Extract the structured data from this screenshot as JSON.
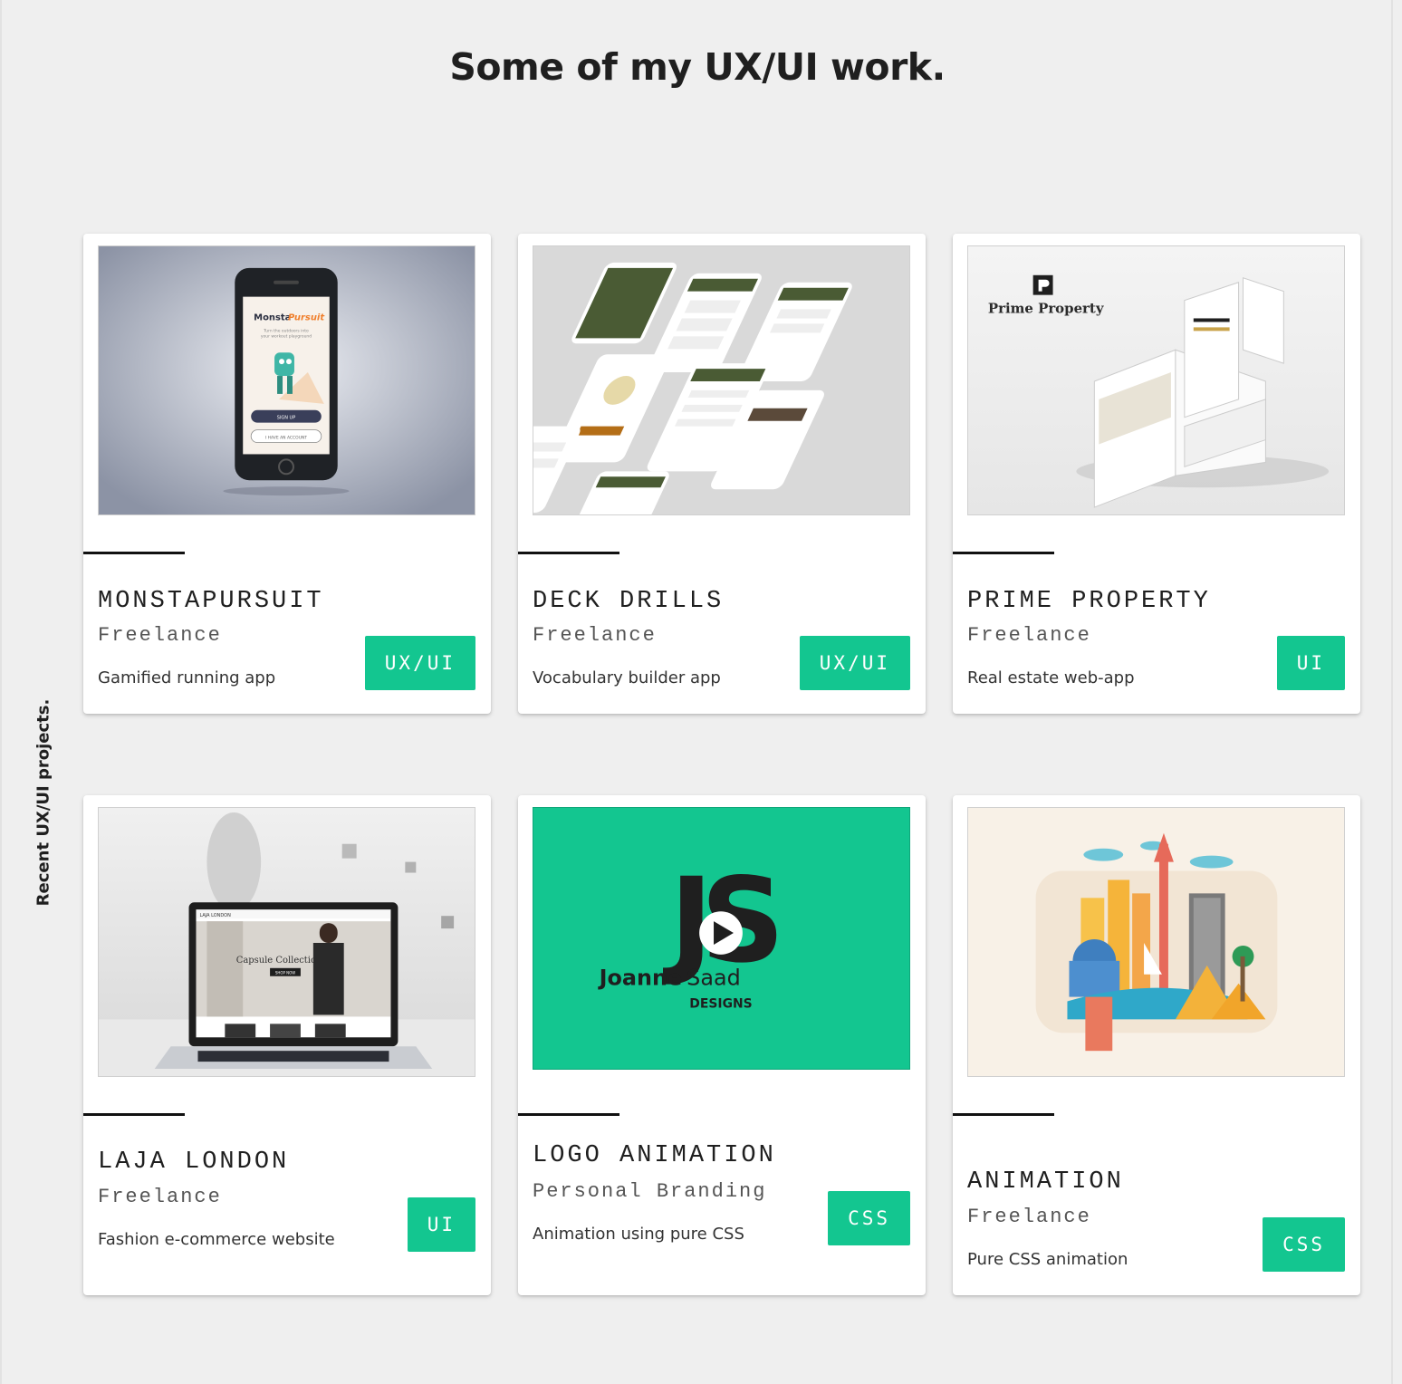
{
  "page": {
    "title": "Some of my UX/UI work."
  },
  "side_label": "Recent UX/UI projects.",
  "colors": {
    "accent": "#13c690",
    "background": "#efefef",
    "card": "#ffffff"
  },
  "projects": [
    {
      "title": "MONSTAPURSUIT",
      "role": "Freelance",
      "description": "Gamified running app",
      "tag": "UX/UI",
      "thumb": {
        "kind": "phone-mockup",
        "app_name_left": "Monsta",
        "app_name_right": "Pursuit",
        "tagline": "Turn the outdoors into your workout playground",
        "primary_button": "SIGN UP",
        "secondary_button": "I HAVE AN ACCOUNT"
      }
    },
    {
      "title": "DECK DRILLS",
      "role": "Freelance",
      "description": "Vocabulary builder app",
      "tag": "UX/UI",
      "thumb": {
        "kind": "app-screens-mockup"
      }
    },
    {
      "title": "PRIME PROPERTY",
      "role": "Freelance",
      "description": "Real estate web-app",
      "tag": "UI",
      "thumb": {
        "kind": "web-app-mockup",
        "brand": "Prime Property"
      }
    },
    {
      "title": "LAJA LONDON",
      "role": "Freelance",
      "description": "Fashion e-commerce website",
      "tag": "UI",
      "thumb": {
        "kind": "laptop-mockup",
        "site_logo": "LAJA LONDON",
        "headline": "Capsule Collection",
        "cta": "SHOP NOW"
      }
    },
    {
      "title": "LOGO ANIMATION",
      "role": "Personal Branding",
      "description": "Animation using pure CSS",
      "tag": "CSS",
      "thumb": {
        "kind": "logo-video",
        "monogram": "JS",
        "name_bold": "Joanne",
        "name_light": "Saad",
        "subline": "DESIGNS",
        "overlay_icon": "play-icon"
      }
    },
    {
      "title": "ANIMATION",
      "role": "Freelance",
      "description": "Pure CSS animation",
      "tag": "CSS",
      "thumb": {
        "kind": "city-illustration"
      }
    }
  ]
}
